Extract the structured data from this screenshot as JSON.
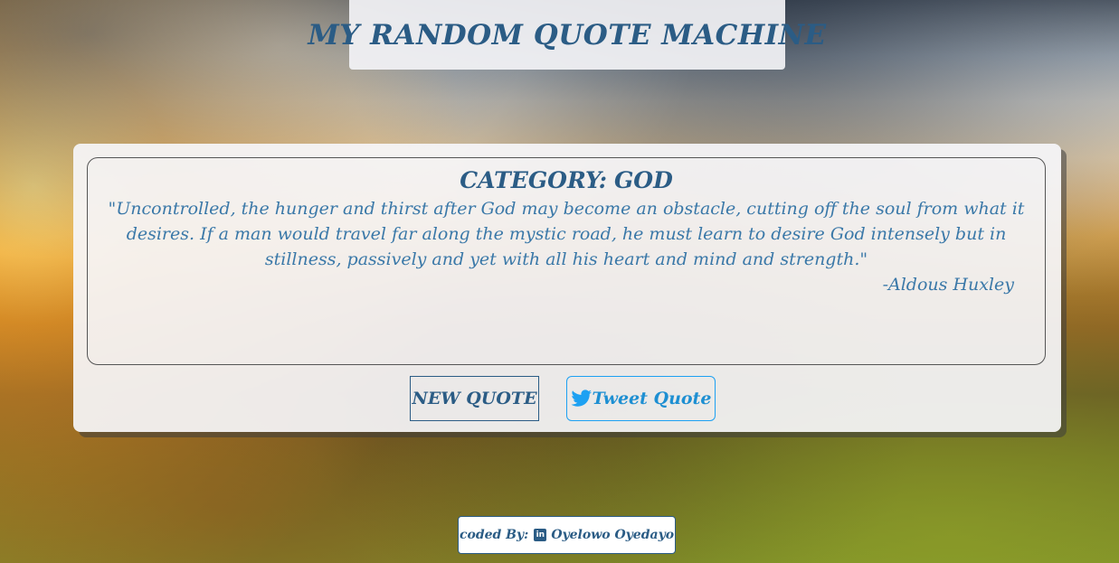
{
  "header": {
    "title": "MY RANDOM QUOTE MACHINE"
  },
  "quote": {
    "category_label": "CATEGORY:",
    "category_value": "GOD",
    "text": "\"Uncontrolled, the hunger and thirst after God may become an obstacle, cutting off the soul from what it desires. If a man would travel far along the mystic road, he must learn to desire God intensely but in stillness, passively and yet with all his heart and mind and strength.\"",
    "author": "-Aldous Huxley"
  },
  "actions": {
    "new_quote_label": "NEW QUOTE",
    "tweet_label": "Tweet Quote",
    "tweet_icon": "twitter-icon"
  },
  "footer": {
    "coded_by_label": "coded By:",
    "linkedin_icon": "linkedin-icon",
    "author_name": "Oyelowo Oyedayo"
  },
  "colors": {
    "primary": "#2b5c85",
    "quote_text": "#3a78a8",
    "twitter": "#1da1f2"
  }
}
